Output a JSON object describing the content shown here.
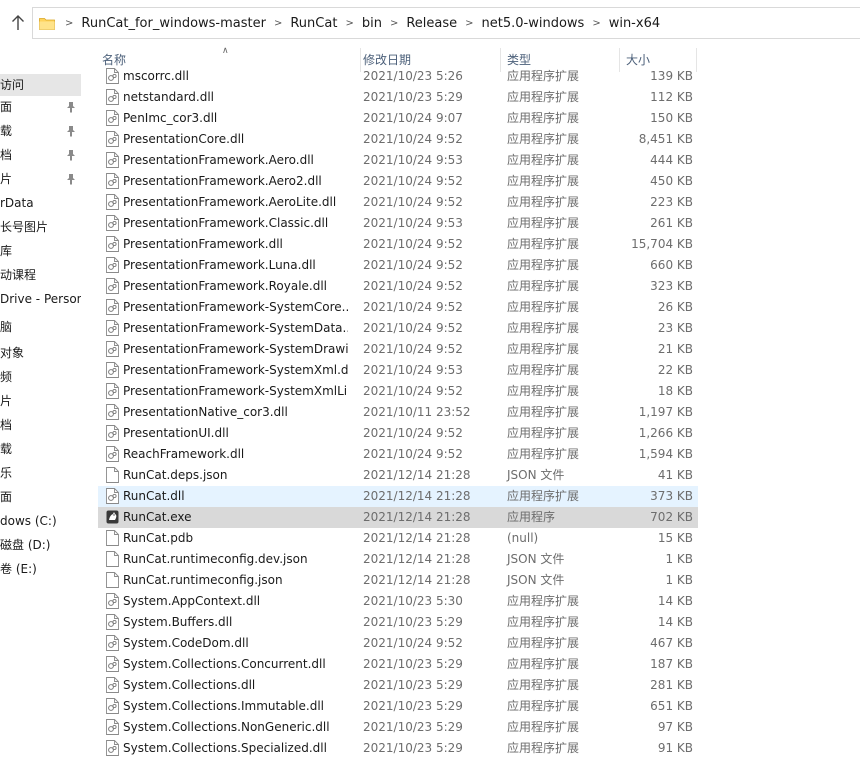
{
  "address": {
    "segments": [
      "RunCat_for_windows-master",
      "RunCat",
      "bin",
      "Release",
      "net5.0-windows",
      "win-x64"
    ]
  },
  "sidebar": {
    "items": [
      {
        "label": "访问",
        "selected": true,
        "pinned": false
      },
      {
        "label": "面",
        "pinned": true
      },
      {
        "label": "载",
        "pinned": true
      },
      {
        "label": "档",
        "pinned": true
      },
      {
        "label": "片",
        "pinned": true
      },
      {
        "label": "rData",
        "pinned": false
      },
      {
        "label": "长号图片",
        "pinned": false
      },
      {
        "label": "库",
        "pinned": false
      },
      {
        "label": "动课程",
        "pinned": false
      },
      {
        "label": "Drive - Persona",
        "pinned": false
      },
      {
        "label": "脑",
        "pinned": false
      },
      {
        "label": "对象",
        "pinned": false
      },
      {
        "label": "频",
        "pinned": false
      },
      {
        "label": "片",
        "pinned": false
      },
      {
        "label": "档",
        "pinned": false
      },
      {
        "label": "载",
        "pinned": false
      },
      {
        "label": "乐",
        "pinned": false
      },
      {
        "label": "面",
        "pinned": false
      },
      {
        "label": "dows (C:)",
        "pinned": false
      },
      {
        "label": "磁盘 (D:)",
        "pinned": false
      },
      {
        "label": "卷 (E:)",
        "pinned": false
      }
    ]
  },
  "columns": {
    "name": "名称",
    "date": "修改日期",
    "type": "类型",
    "size": "大小"
  },
  "files": [
    {
      "name": "mscorrc.dll",
      "date": "2021/10/23 5:26",
      "type": "应用程序扩展",
      "size": "139 KB",
      "icon": "dll"
    },
    {
      "name": "netstandard.dll",
      "date": "2021/10/23 5:29",
      "type": "应用程序扩展",
      "size": "112 KB",
      "icon": "dll"
    },
    {
      "name": "PenImc_cor3.dll",
      "date": "2021/10/24 9:07",
      "type": "应用程序扩展",
      "size": "150 KB",
      "icon": "dll"
    },
    {
      "name": "PresentationCore.dll",
      "date": "2021/10/24 9:52",
      "type": "应用程序扩展",
      "size": "8,451 KB",
      "icon": "dll"
    },
    {
      "name": "PresentationFramework.Aero.dll",
      "date": "2021/10/24 9:53",
      "type": "应用程序扩展",
      "size": "444 KB",
      "icon": "dll"
    },
    {
      "name": "PresentationFramework.Aero2.dll",
      "date": "2021/10/24 9:52",
      "type": "应用程序扩展",
      "size": "450 KB",
      "icon": "dll"
    },
    {
      "name": "PresentationFramework.AeroLite.dll",
      "date": "2021/10/24 9:52",
      "type": "应用程序扩展",
      "size": "223 KB",
      "icon": "dll"
    },
    {
      "name": "PresentationFramework.Classic.dll",
      "date": "2021/10/24 9:53",
      "type": "应用程序扩展",
      "size": "261 KB",
      "icon": "dll"
    },
    {
      "name": "PresentationFramework.dll",
      "date": "2021/10/24 9:52",
      "type": "应用程序扩展",
      "size": "15,704 KB",
      "icon": "dll"
    },
    {
      "name": "PresentationFramework.Luna.dll",
      "date": "2021/10/24 9:52",
      "type": "应用程序扩展",
      "size": "660 KB",
      "icon": "dll"
    },
    {
      "name": "PresentationFramework.Royale.dll",
      "date": "2021/10/24 9:52",
      "type": "应用程序扩展",
      "size": "323 KB",
      "icon": "dll"
    },
    {
      "name": "PresentationFramework-SystemCore....",
      "date": "2021/10/24 9:52",
      "type": "应用程序扩展",
      "size": "26 KB",
      "icon": "dll"
    },
    {
      "name": "PresentationFramework-SystemData....",
      "date": "2021/10/24 9:52",
      "type": "应用程序扩展",
      "size": "23 KB",
      "icon": "dll"
    },
    {
      "name": "PresentationFramework-SystemDrawi...",
      "date": "2021/10/24 9:52",
      "type": "应用程序扩展",
      "size": "21 KB",
      "icon": "dll"
    },
    {
      "name": "PresentationFramework-SystemXml.dll",
      "date": "2021/10/24 9:53",
      "type": "应用程序扩展",
      "size": "22 KB",
      "icon": "dll"
    },
    {
      "name": "PresentationFramework-SystemXmlLi...",
      "date": "2021/10/24 9:52",
      "type": "应用程序扩展",
      "size": "18 KB",
      "icon": "dll"
    },
    {
      "name": "PresentationNative_cor3.dll",
      "date": "2021/10/11 23:52",
      "type": "应用程序扩展",
      "size": "1,197 KB",
      "icon": "dll"
    },
    {
      "name": "PresentationUI.dll",
      "date": "2021/10/24 9:52",
      "type": "应用程序扩展",
      "size": "1,266 KB",
      "icon": "dll"
    },
    {
      "name": "ReachFramework.dll",
      "date": "2021/10/24 9:52",
      "type": "应用程序扩展",
      "size": "1,594 KB",
      "icon": "dll"
    },
    {
      "name": "RunCat.deps.json",
      "date": "2021/12/14 21:28",
      "type": "JSON 文件",
      "size": "41 KB",
      "icon": "doc"
    },
    {
      "name": "RunCat.dll",
      "date": "2021/12/14 21:28",
      "type": "应用程序扩展",
      "size": "373 KB",
      "icon": "dll",
      "state": "hover"
    },
    {
      "name": "RunCat.exe",
      "date": "2021/12/14 21:28",
      "type": "应用程序",
      "size": "702 KB",
      "icon": "exe",
      "state": "selected"
    },
    {
      "name": "RunCat.pdb",
      "date": "2021/12/14 21:28",
      "type": "(null)",
      "size": "15 KB",
      "icon": "doc"
    },
    {
      "name": "RunCat.runtimeconfig.dev.json",
      "date": "2021/12/14 21:28",
      "type": "JSON 文件",
      "size": "1 KB",
      "icon": "doc"
    },
    {
      "name": "RunCat.runtimeconfig.json",
      "date": "2021/12/14 21:28",
      "type": "JSON 文件",
      "size": "1 KB",
      "icon": "doc"
    },
    {
      "name": "System.AppContext.dll",
      "date": "2021/10/23 5:30",
      "type": "应用程序扩展",
      "size": "14 KB",
      "icon": "dll"
    },
    {
      "name": "System.Buffers.dll",
      "date": "2021/10/23 5:29",
      "type": "应用程序扩展",
      "size": "14 KB",
      "icon": "dll"
    },
    {
      "name": "System.CodeDom.dll",
      "date": "2021/10/24 9:52",
      "type": "应用程序扩展",
      "size": "467 KB",
      "icon": "dll"
    },
    {
      "name": "System.Collections.Concurrent.dll",
      "date": "2021/10/23 5:29",
      "type": "应用程序扩展",
      "size": "187 KB",
      "icon": "dll"
    },
    {
      "name": "System.Collections.dll",
      "date": "2021/10/23 5:29",
      "type": "应用程序扩展",
      "size": "281 KB",
      "icon": "dll"
    },
    {
      "name": "System.Collections.Immutable.dll",
      "date": "2021/10/23 5:29",
      "type": "应用程序扩展",
      "size": "651 KB",
      "icon": "dll"
    },
    {
      "name": "System.Collections.NonGeneric.dll",
      "date": "2021/10/23 5:29",
      "type": "应用程序扩展",
      "size": "97 KB",
      "icon": "dll"
    },
    {
      "name": "System.Collections.Specialized.dll",
      "date": "2021/10/23 5:29",
      "type": "应用程序扩展",
      "size": "91 KB",
      "icon": "dll"
    }
  ]
}
